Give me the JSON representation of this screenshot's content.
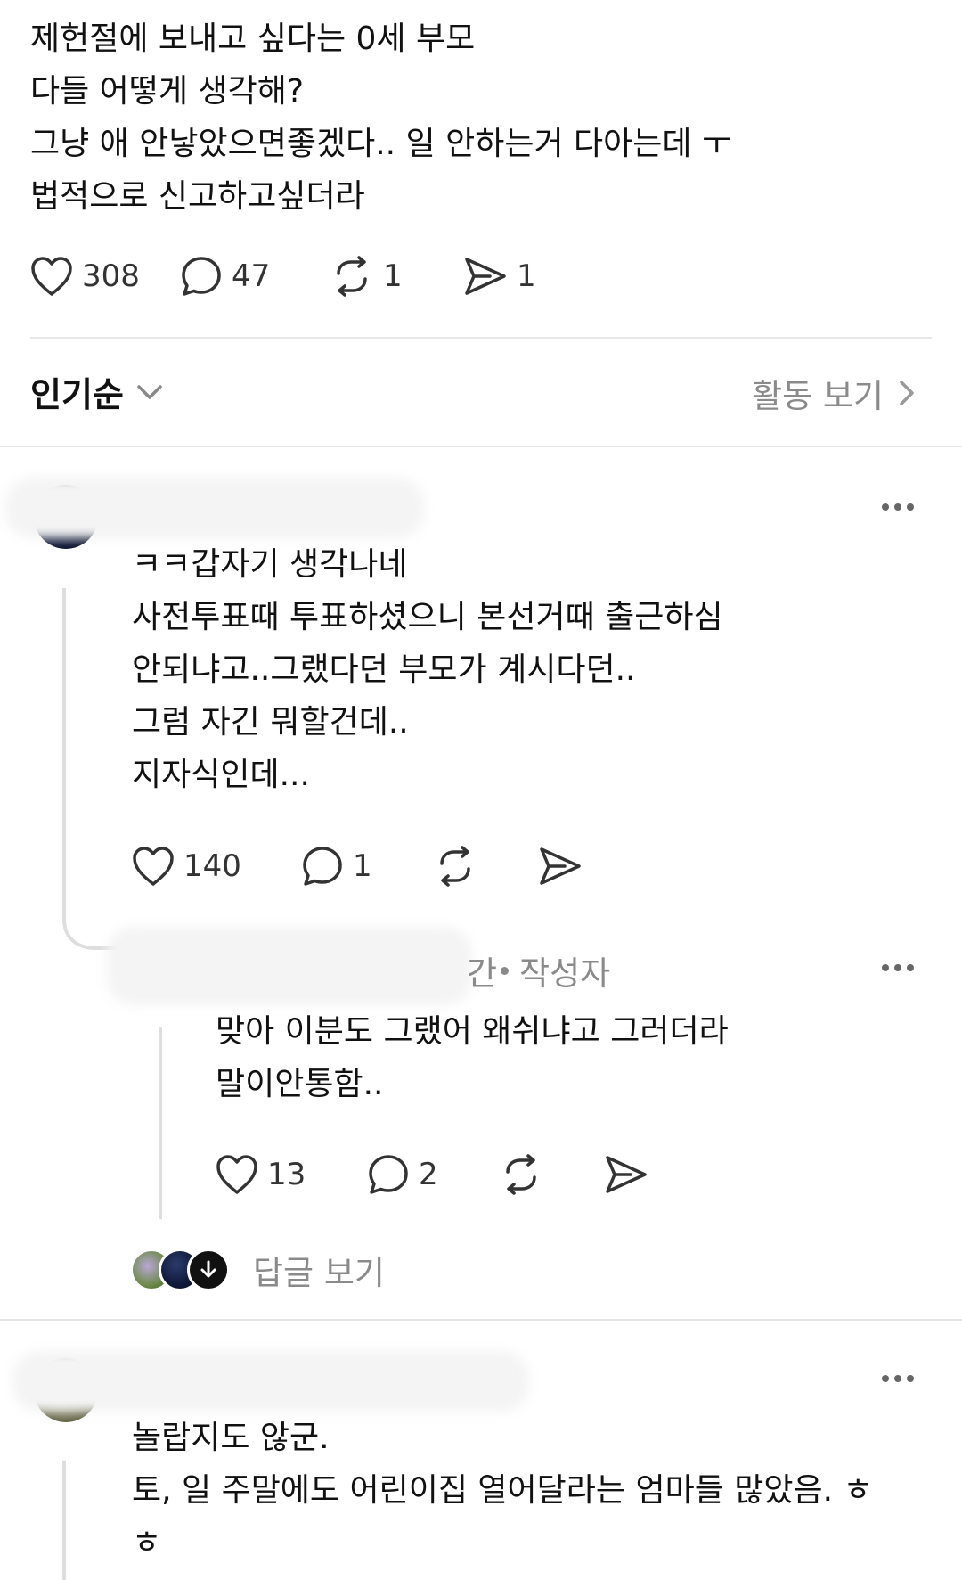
{
  "post": {
    "lines": [
      "제헌절에 보내고 싶다는 0세 부모",
      "다들 어떻게 생각해?",
      "그냥 애 안낳았으면좋겠다.. 일 안하는거 다아는데 ㅜ",
      "법적으로 신고하고싶더라"
    ],
    "likes": "308",
    "comments": "47",
    "reposts": "1",
    "shares": "1"
  },
  "sort": {
    "label": "인기순",
    "activity_label": "활동 보기"
  },
  "comment1": {
    "lines": [
      "ㅋㅋ갑자기 생각나네",
      "사전투표때 투표하셨으니 본선거때 출근하심",
      "안되냐고..그랬다던 부모가 계시다던..",
      "그럼 자긴 뭐할건데..",
      "지자식인데..."
    ],
    "likes": "140",
    "comments": "1"
  },
  "reply1": {
    "name_fragment": "간",
    "author_tag": "작성자",
    "lines": [
      "맞아 이분도 그랬어 왜쉬냐고 그러더라",
      "말이안통함.."
    ],
    "likes": "13",
    "comments": "2"
  },
  "view_replies": "답글 보기",
  "comment2": {
    "lines": [
      "놀랍지도 않군.",
      "토, 일 주말에도 어린이집 열어달라는 엄마들 많았음. ㅎ",
      "ㅎ"
    ]
  },
  "icons": {
    "like": "heart-icon",
    "comment": "comment-bubble-icon",
    "repost": "repost-icon",
    "share": "send-icon",
    "more": "more-dots-icon",
    "sort": "chevron-down-icon",
    "activity": "chevron-right-icon"
  }
}
